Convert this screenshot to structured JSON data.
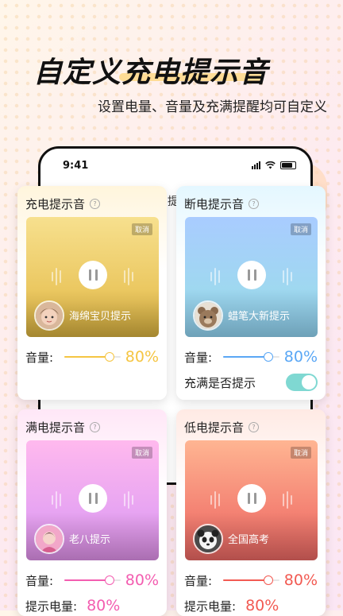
{
  "headline": "自定义充电提示音",
  "subtitle": "设置电量、音量及充满提醒均可自定义",
  "phone": {
    "time": "9:41",
    "peek_text": "提"
  },
  "cards": [
    {
      "title": "充电提示音",
      "cancel": "取消",
      "sound_name": "海绵宝贝提示",
      "volume_label": "音量:",
      "volume_pct": 80,
      "volume_text": "80%",
      "accent": "#f5c542"
    },
    {
      "title": "断电提示音",
      "cancel": "取消",
      "sound_name": "蜡笔大新提示",
      "volume_label": "音量:",
      "volume_pct": 80,
      "volume_text": "80%",
      "accent": "#5aa7f5",
      "toggle_label": "充满是否提示",
      "toggle_on": true
    },
    {
      "title": "满电提示音",
      "cancel": "取消",
      "sound_name": "老八提示",
      "volume_label": "音量:",
      "volume_pct": 80,
      "volume_text": "80%",
      "accent": "#f35db0",
      "level_label": "提示电量:",
      "level_text": "80%"
    },
    {
      "title": "低电提示音",
      "cancel": "取消",
      "sound_name": "全国高考",
      "volume_label": "音量:",
      "volume_pct": 80,
      "volume_text": "80%",
      "accent": "#f25a52",
      "level_label": "提示电量:",
      "level_text": "80%"
    }
  ],
  "icons": {
    "help": "?"
  }
}
